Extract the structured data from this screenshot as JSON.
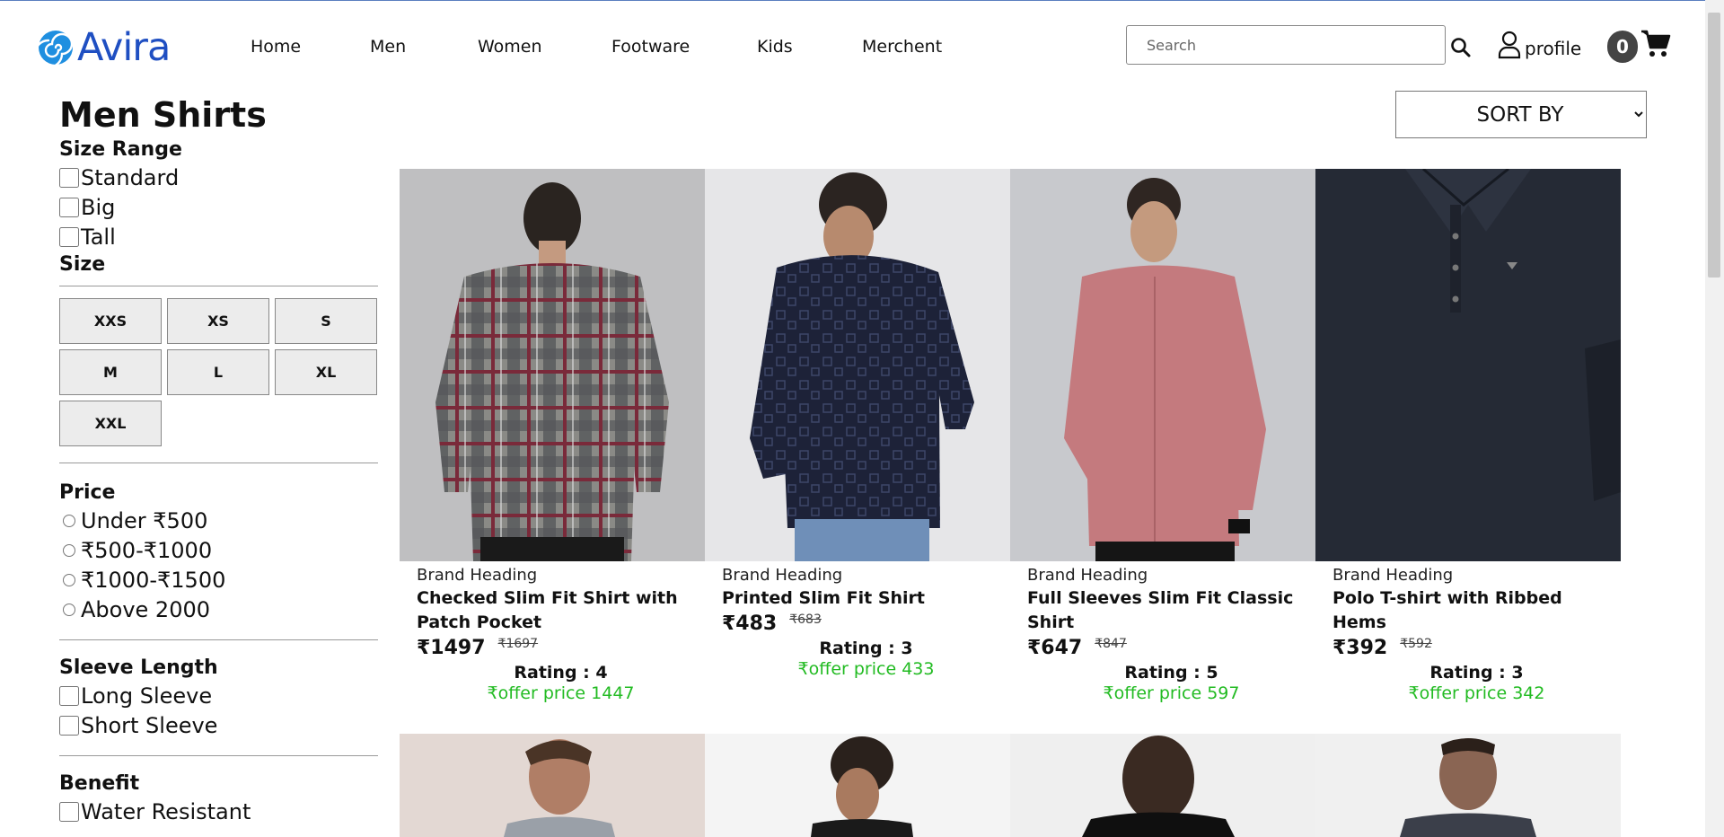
{
  "brand": {
    "name": "Avira"
  },
  "nav": [
    "Home",
    "Men",
    "Women",
    "Footware",
    "Kids",
    "Merchent"
  ],
  "search": {
    "placeholder": "Search"
  },
  "profile_label": "profile",
  "cart_count": "0",
  "sort": {
    "label": "SORT BY"
  },
  "page_title": "Men Shirts",
  "filters": {
    "size_range": {
      "title": "Size Range",
      "options": [
        "Standard",
        "Big",
        "Tall"
      ]
    },
    "size": {
      "title": "Size",
      "options": [
        "XXS",
        "XS",
        "S",
        "M",
        "L",
        "XL",
        "XXL"
      ]
    },
    "price": {
      "title": "Price",
      "options": [
        "Under ₹500",
        "₹500-₹1000",
        "₹1000-₹1500",
        "Above 2000"
      ]
    },
    "sleeve": {
      "title": "Sleeve Length",
      "options": [
        "Long Sleeve",
        "Short Sleeve"
      ]
    },
    "benefit": {
      "title": "Benefit",
      "options": [
        "Water Resistant"
      ]
    }
  },
  "products": [
    {
      "brand": "Brand Heading",
      "name": "Checked Slim Fit Shirt with Patch Pocket",
      "price": "₹1497",
      "mrp": "₹1697",
      "rating": "Rating : 4",
      "offer": "₹offer price 1447"
    },
    {
      "brand": "Brand Heading",
      "name": "Printed Slim Fit Shirt",
      "price": "₹483",
      "mrp": "₹683",
      "rating": "Rating : 3",
      "offer": "₹offer price 433"
    },
    {
      "brand": "Brand Heading",
      "name": "Full Sleeves Slim Fit Classic Shirt",
      "price": "₹647",
      "mrp": "₹847",
      "rating": "Rating : 5",
      "offer": "₹offer price 597"
    },
    {
      "brand": "Brand Heading",
      "name": "Polo T-shirt with Ribbed Hems",
      "price": "₹392",
      "mrp": "₹592",
      "rating": "Rating : 3",
      "offer": "₹offer price 342"
    }
  ],
  "colors": {
    "accent": "#1f4fc2",
    "offer": "#22bb22"
  }
}
